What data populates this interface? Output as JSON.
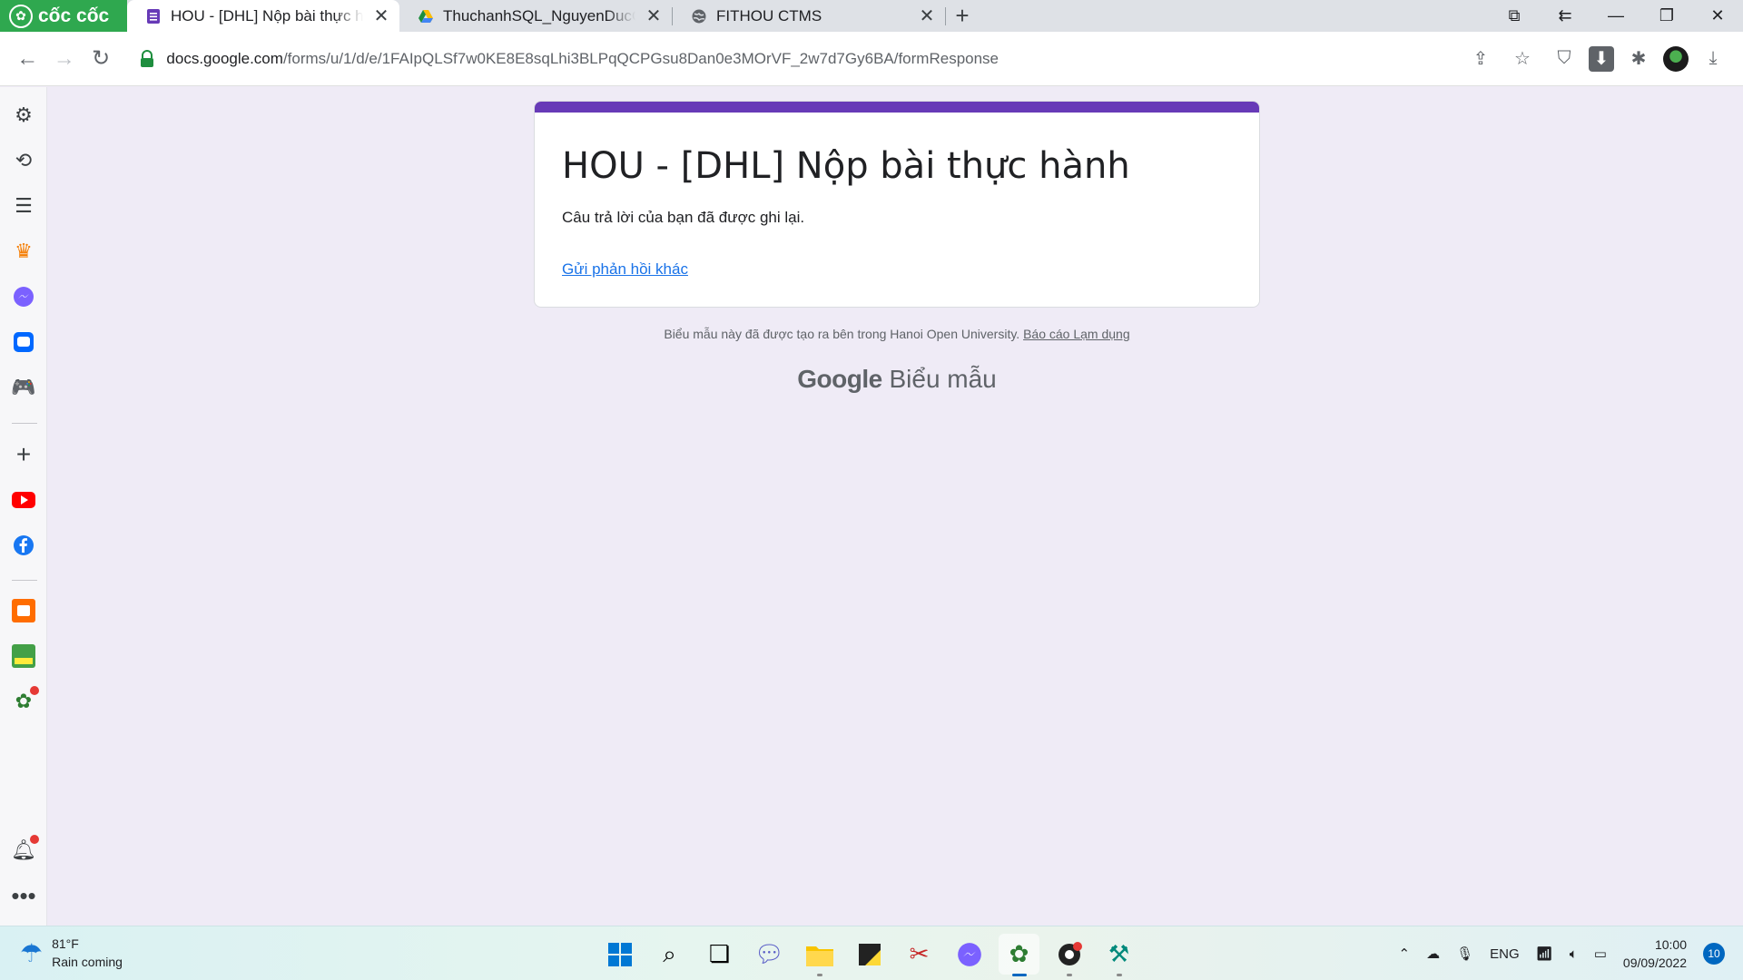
{
  "browser": {
    "brand": "cốc cốc",
    "tabs": [
      {
        "title": "HOU - [DHL] Nộp bài thực hành",
        "active": true
      },
      {
        "title": "ThuchanhSQL_NguyenDucCuong",
        "active": false
      },
      {
        "title": "FITHOU CTMS",
        "active": false
      }
    ],
    "url_host": "docs.google.com",
    "url_path": "/forms/u/1/d/e/1FAIpQLSf7w0KE8E8sqLhi3BLPqQCPGsu8Dan0e3MOrVF_2w7d7Gy6BA/formResponse"
  },
  "sidebar": {
    "items": [
      "gear-icon",
      "history-icon",
      "list-icon",
      "crown-icon",
      "messenger-icon",
      "zalo-icon",
      "gamepad-icon",
      "plus-icon",
      "youtube-icon",
      "facebook-icon",
      "shop-icon",
      "coupon-icon",
      "coccoc-icon",
      "bell-icon",
      "more-icon"
    ]
  },
  "form": {
    "title": "HOU - [DHL] Nộp bài thực hành",
    "message": "Câu trả lời của bạn đã được ghi lại.",
    "link": "Gửi phản hồi khác",
    "accent_color": "#673ab7"
  },
  "footer": {
    "note": "Biểu mẫu này đã được tạo ra bên trong Hanoi Open University.",
    "abuse_link": "Báo cáo Lạm dụng",
    "logo_google": "Google",
    "logo_product": "Biểu mẫu"
  },
  "taskbar": {
    "temp": "81°F",
    "weather": "Rain coming",
    "lang": "ENG",
    "time": "10:00",
    "date": "09/09/2022",
    "notifications": "10"
  }
}
